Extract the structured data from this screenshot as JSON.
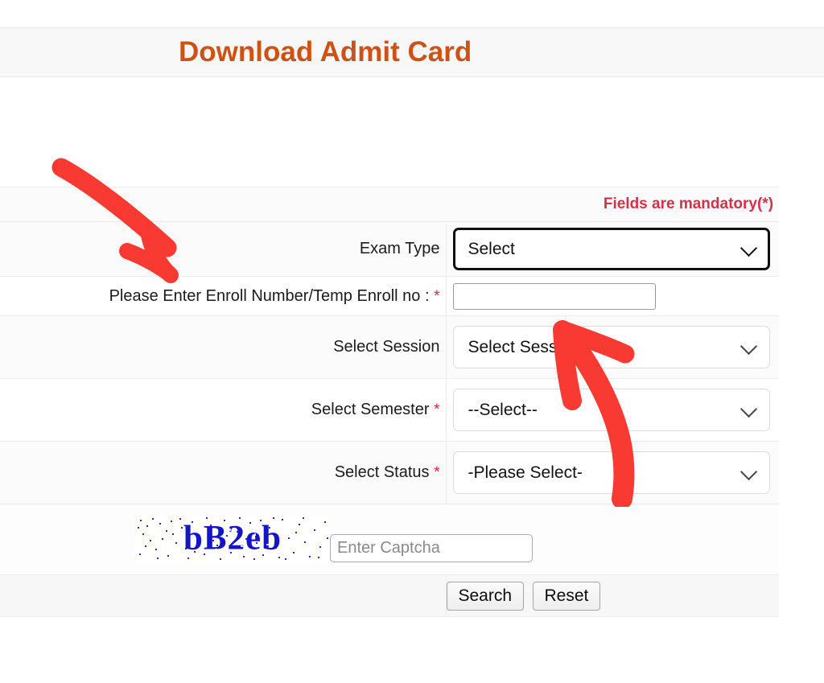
{
  "header": {
    "title": "Download Admit Card",
    "title_color": "#cc5216"
  },
  "form": {
    "mandatory_note": "Fields are mandatory(*)",
    "mandatory_note_color": "#d3314a",
    "required_marker": "*",
    "rows": [
      {
        "label": "Exam Type",
        "required": false,
        "control": "select",
        "value": "Select",
        "focused": true
      },
      {
        "label": "Please Enter Enroll Number/Temp Enroll no :",
        "required": true,
        "control": "text",
        "value": "",
        "placeholder": ""
      },
      {
        "label": "Select Session",
        "required": false,
        "control": "select",
        "value": "Select Session",
        "focused": false
      },
      {
        "label": "Select Semester",
        "required": true,
        "control": "select",
        "value": "--Select--",
        "focused": false
      },
      {
        "label": "Select Status",
        "required": true,
        "control": "select",
        "value": "-Please Select-",
        "focused": false
      }
    ],
    "captcha": {
      "image_text": "bB2eb",
      "image_text_color": "#1414c8",
      "input_placeholder": "Enter Captcha",
      "input_value": ""
    },
    "buttons": {
      "search_label": "Search",
      "reset_label": "Reset"
    }
  },
  "annotations": {
    "color": "#f93a32",
    "arrow_1": "down-right arrow pointing at Exam Type row",
    "arrow_2": "up-left curved arrow pointing at Select Session field"
  }
}
